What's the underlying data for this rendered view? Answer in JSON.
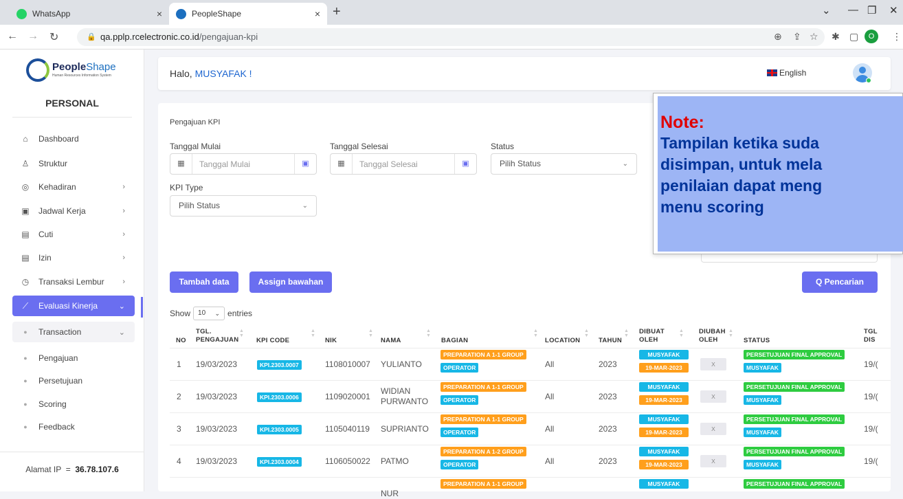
{
  "browser": {
    "tabs": [
      {
        "title": "WhatsApp",
        "favicon_color": "#25d366",
        "active": false
      },
      {
        "title": "PeopleShape",
        "favicon_color": "#1c6fbf",
        "active": true
      }
    ],
    "new_tab": "+",
    "url_host": "qa.pplp.rcelectronic.co.id",
    "url_path": "/pengajuan-kpi",
    "profile_initial": "O"
  },
  "brand": {
    "name_bold": "People",
    "name_light": "Shape",
    "tagline": "Human Resources Information System"
  },
  "sidebar": {
    "section_title": "PERSONAL",
    "items": [
      {
        "icon": "home-icon",
        "glyph": "⌂",
        "label": "Dashboard",
        "has_chevron": false
      },
      {
        "icon": "org-structure-icon",
        "glyph": "♙",
        "label": "Struktur",
        "has_chevron": false
      },
      {
        "icon": "fingerprint-icon",
        "glyph": "◎",
        "label": "Kehadiran",
        "has_chevron": true
      },
      {
        "icon": "briefcase-icon",
        "glyph": "▣",
        "label": "Jadwal Kerja",
        "has_chevron": true
      },
      {
        "icon": "calendar-icon",
        "glyph": "▤",
        "label": "Cuti",
        "has_chevron": true
      },
      {
        "icon": "calendar-icon",
        "glyph": "▤",
        "label": "Izin",
        "has_chevron": true
      },
      {
        "icon": "clock-icon",
        "glyph": "◷",
        "label": "Transaksi Lembur",
        "has_chevron": true
      },
      {
        "icon": "chart-line-icon",
        "glyph": "⟋",
        "label": "Evaluasi Kinerja",
        "has_chevron": true,
        "active": true
      }
    ],
    "transaction_label": "Transaction",
    "sub_items": [
      "Pengajuan",
      "Persetujuan",
      "Scoring",
      "Feedback"
    ],
    "ip_label": "Alamat IP",
    "ip_sep": "=",
    "ip_value": "36.78.107.6"
  },
  "header": {
    "greeting": "Halo,",
    "username": "MUSYAFAK",
    "exclaim": " !",
    "language": "English"
  },
  "main": {
    "title": "Pengajuan KPI",
    "filters": {
      "start_label": "Tanggal Mulai",
      "start_placeholder": "Tanggal Mulai",
      "end_label": "Tanggal Selesai",
      "end_placeholder": "Tanggal Selesai",
      "status_label": "Status",
      "status_value": "Pilih Status",
      "kpi_type_label": "KPI Type",
      "kpi_type_value": "Pilih Status"
    },
    "buttons": {
      "add": "Tambah data",
      "assign": "Assign bawahan",
      "search": "Q  Pencarian"
    },
    "show_label": "Show",
    "show_value": "10",
    "entries_label": "entries"
  },
  "table": {
    "headers": [
      "NO",
      "TGL. PENGAJUAN",
      "KPI CODE",
      "NIK",
      "NAMA",
      "BAGIAN",
      "LOCATION",
      "TAHUN",
      "DIBUAT OLEH",
      "DIUBAH OLEH",
      "STATUS",
      "TGL DIS"
    ],
    "rows": [
      {
        "no": "1",
        "date": "19/03/2023",
        "code": "KPI.2303.0007",
        "nik": "1108010007",
        "nama": "YULIANTO",
        "bagian": "PREPARATION A 1-1 GROUP",
        "jabatan": "OPERATOR",
        "location": "All",
        "tahun": "2023",
        "dibuat": "MUSYAFAK",
        "dibuat_date": "19-MAR-2023",
        "diubah": "X",
        "status": "PERSETUJUAN FINAL APPROVAL",
        "status_by": "MUSYAFAK",
        "tgl_dis": "19/("
      },
      {
        "no": "2",
        "date": "19/03/2023",
        "code": "KPI.2303.0006",
        "nik": "1109020001",
        "nama": "WIDIAN PURWANTO",
        "bagian": "PREPARATION A 1-1 GROUP",
        "jabatan": "OPERATOR",
        "location": "All",
        "tahun": "2023",
        "dibuat": "MUSYAFAK",
        "dibuat_date": "19-MAR-2023",
        "diubah": "X",
        "status": "PERSETUJUAN FINAL APPROVAL",
        "status_by": "MUSYAFAK",
        "tgl_dis": "19/("
      },
      {
        "no": "3",
        "date": "19/03/2023",
        "code": "KPI.2303.0005",
        "nik": "1105040119",
        "nama": "SUPRIANTO",
        "bagian": "PREPARATION A 1-1 GROUP",
        "jabatan": "OPERATOR",
        "location": "All",
        "tahun": "2023",
        "dibuat": "MUSYAFAK",
        "dibuat_date": "19-MAR-2023",
        "diubah": "X",
        "status": "PERSETUJUAN FINAL APPROVAL",
        "status_by": "MUSYAFAK",
        "tgl_dis": "19/("
      },
      {
        "no": "4",
        "date": "19/03/2023",
        "code": "KPI.2303.0004",
        "nik": "1106050022",
        "nama": "PATMO",
        "bagian": "PREPARATION A 1-2 GROUP",
        "jabatan": "OPERATOR",
        "location": "All",
        "tahun": "2023",
        "dibuat": "MUSYAFAK",
        "dibuat_date": "19-MAR-2023",
        "diubah": "X",
        "status": "PERSETUJUAN FINAL APPROVAL",
        "status_by": "MUSYAFAK",
        "tgl_dis": "19/("
      },
      {
        "no": "",
        "date": "",
        "code": "",
        "nik": "",
        "nama": "NUR",
        "bagian": "PREPARATION A 1-1 GROUP",
        "jabatan": "",
        "location": "",
        "tahun": "",
        "dibuat": "MUSYAFAK",
        "dibuat_date": "",
        "diubah": "",
        "status": "PERSETUJUAN FINAL APPROVAL",
        "status_by": "",
        "tgl_dis": ""
      }
    ]
  },
  "note": {
    "heading": "Note:",
    "lines": [
      "Tampilan ketika suda",
      "disimpan, untuk mela",
      "penilaian dapat meng",
      "menu scoring"
    ]
  },
  "colors": {
    "accent": "#6a6ef0",
    "badge_blue": "#17b7e6",
    "badge_orange": "#ff9f1c",
    "badge_green": "#2ecc40",
    "note_bg": "#9db5f5",
    "note_heading": "#e00000",
    "note_text": "#003399"
  }
}
